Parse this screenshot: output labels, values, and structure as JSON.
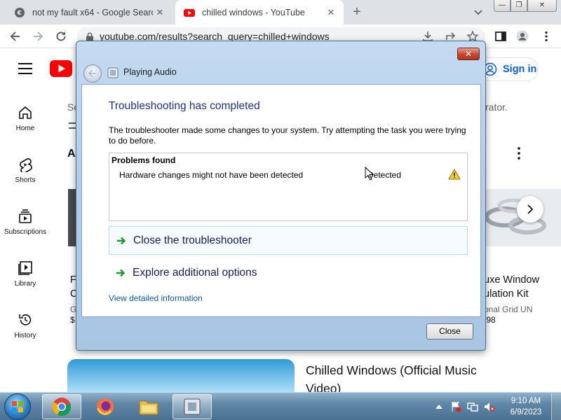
{
  "browser": {
    "tabs": [
      {
        "title": "not my fault x64 - Google Search",
        "favicon": "google-icon",
        "active": false
      },
      {
        "title": "chilled windows - YouTube",
        "favicon": "youtube-icon",
        "active": true
      }
    ],
    "new_tab": "+",
    "url": "youtube.com/results?search_query=chilled+windows",
    "window_buttons": {
      "minimize": "—",
      "maximize": "❐",
      "close": "✕"
    }
  },
  "youtube": {
    "sign_in": "Sign in",
    "sidebar": [
      {
        "label": "Home",
        "icon": "home-icon"
      },
      {
        "label": "Shorts",
        "icon": "shorts-icon"
      },
      {
        "label": "Subscriptions",
        "icon": "subscriptions-icon"
      },
      {
        "label": "Library",
        "icon": "library-icon"
      },
      {
        "label": "History",
        "icon": "history-icon"
      }
    ],
    "fragments": {
      "search_prefix": "Sc",
      "partial_right": "rator.",
      "shelf_letter": "A",
      "left_title_1": "F",
      "left_title_2": "C",
      "left_meta": "G",
      "left_price": "$",
      "right_title_1": "uxe Window",
      "right_title_2": "ulation Kit",
      "right_meta": "onal Grid UN",
      "right_price": ".98"
    },
    "video_title": "Chilled Windows (Official Music Video)"
  },
  "dialog": {
    "title": "Playing Audio",
    "close": "✕",
    "heading": "Troubleshooting has completed",
    "description": "The troubleshooter made some changes to your system. Try attempting the task you were trying to do before.",
    "problems_header": "Problems found",
    "problems": [
      {
        "text": "Hardware changes might not have been detected",
        "status": "Detected",
        "icon": "warning-icon"
      }
    ],
    "links": [
      {
        "label": "Close the troubleshooter",
        "icon": "green-arrow-icon"
      },
      {
        "label": "Explore additional options",
        "icon": "green-arrow-icon"
      }
    ],
    "detail_link": "View detailed information",
    "close_button": "Close"
  },
  "taskbar": {
    "apps": [
      {
        "name": "chrome-icon",
        "active": true
      },
      {
        "name": "firefox-icon",
        "active": false
      },
      {
        "name": "explorer-icon",
        "active": false
      },
      {
        "name": "troubleshooter-icon",
        "active": true
      }
    ],
    "time": "9:10 AM",
    "date": "6/9/2023"
  }
}
